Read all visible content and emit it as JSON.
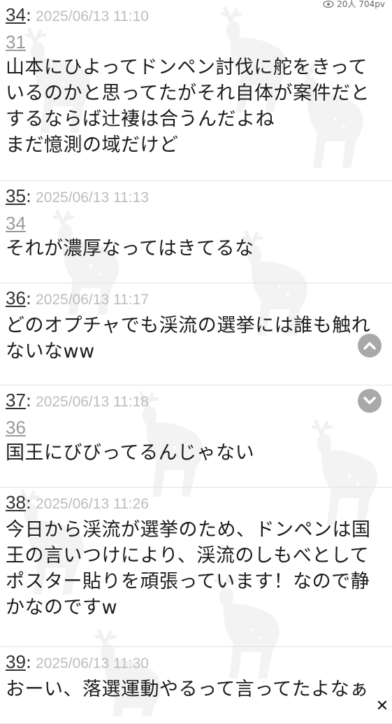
{
  "stats": {
    "viewers": "20人",
    "pageviews": "704pv",
    "icon": "eye-icon"
  },
  "posts": [
    {
      "num": "34",
      "date": "2025/06/13 11:10",
      "reply_to": "31",
      "lines": [
        "山本にひよってドンペン討伐に舵をきって",
        "いるのかと思ってたがそれ自体が案件だと",
        "するならば辻褄は合うんだよね",
        "まだ憶測の域だけど"
      ]
    },
    {
      "num": "35",
      "date": "2025/06/13 11:13",
      "reply_to": "34",
      "lines": [
        "それが濃厚なってはきてるな"
      ]
    },
    {
      "num": "36",
      "date": "2025/06/13 11:17",
      "reply_to": "",
      "lines": [
        "どのオプチャでも渓流の選挙には誰も触れ",
        "ないなww"
      ]
    },
    {
      "num": "37",
      "date": "2025/06/13 11:18",
      "reply_to": "36",
      "lines": [
        "国王にびびってるんじゃない"
      ]
    },
    {
      "num": "38",
      "date": "2025/06/13 11:26",
      "reply_to": "",
      "lines": [
        "今日から渓流が選挙のため、ドンペンは国",
        "王の言いつけにより、渓流のしもべとして",
        "ポスター貼りを頑張っています！なので静",
        "かなのですw"
      ]
    },
    {
      "num": "39",
      "date": "2025/06/13 11:30",
      "reply_to": "",
      "lines": [
        "おーい、落選運動やるって言ってたよなぁ"
      ]
    }
  ],
  "controls": {
    "scroll_up_icon": "chevron-up-icon",
    "scroll_down_icon": "chevron-down-icon",
    "close_icon": "close-icon",
    "close_glyph": "✕"
  },
  "colors": {
    "post_number": "#333333",
    "timestamp": "#bdbdbd",
    "reply_link": "#9a9a9a",
    "divider": "#e2e2e2",
    "scroll_button": "#a9a9a9"
  }
}
